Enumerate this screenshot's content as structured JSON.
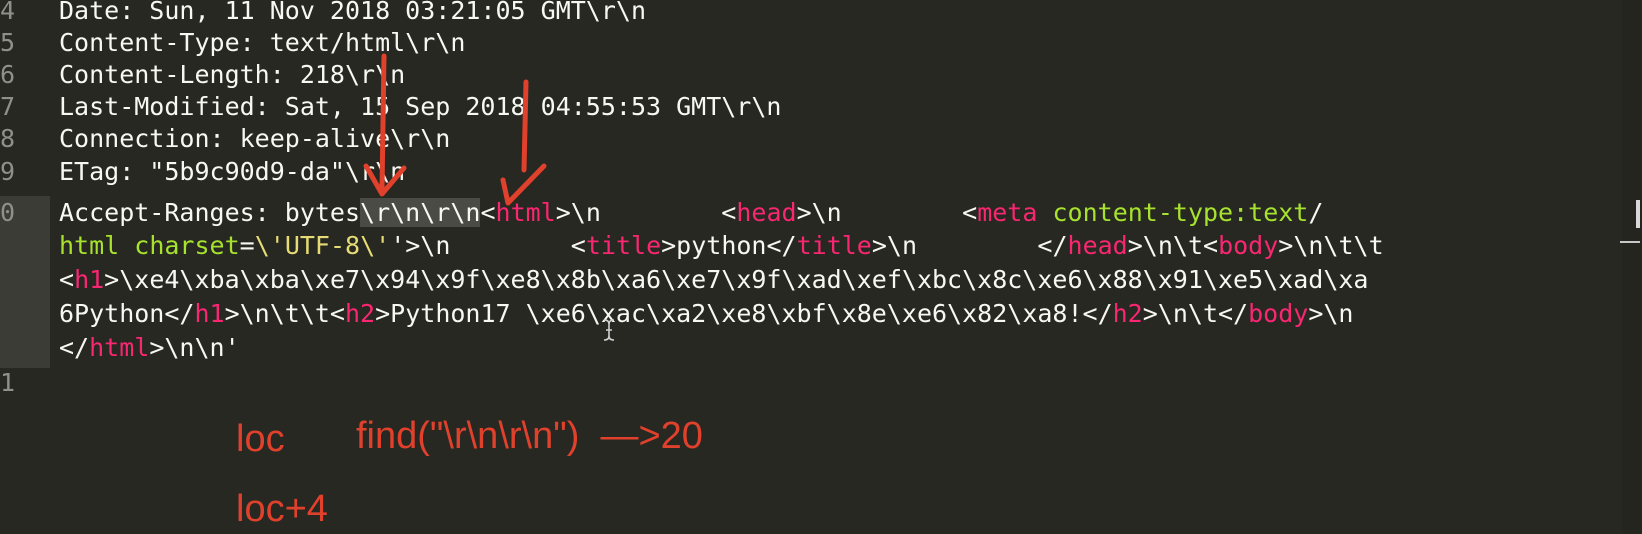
{
  "editor": {
    "line_numbers": [
      "4",
      "5",
      "6",
      "7",
      "8",
      "9",
      "0",
      "1"
    ],
    "lines": {
      "l4": "Date: Sun, 11 Nov 2018 03:21:05 GMT\\r\\n",
      "l5": "Content-Type: text/html\\r\\n",
      "l6": "Content-Length: 218\\r\\n",
      "l7": "Last-Modified: Sat, 15 Sep 2018 04:55:53 GMT\\r\\n",
      "l8": "Connection: keep-alive\\r\\n",
      "l9": "ETag: \"5b9c90d9-da\"\\r\\n",
      "l10": {
        "s1_prefix": "Accept-Ranges: bytes",
        "s1_selected": "\\r\\n\\r\\n",
        "s1_open1": "<",
        "s1_tag_html": "html",
        "s1_rest1": ">\\n        <",
        "s1_tag_head": "head",
        "s1_rest2": ">\\n        <",
        "s1_tag_meta": "meta",
        "s1_space": " ",
        "s1_attr": "content-type:text",
        "s1_slash": "/",
        "s2_attr2": "html",
        "s2_space": " ",
        "s2_attr3": "charset",
        "s2_eq": "=",
        "s2_q1": "\\'",
        "s2_val": "UTF-8",
        "s2_q2": "\\'",
        "s2_rest1": "'>\\n        <",
        "s2_tag_title": "title",
        "s2_rest2": ">python</",
        "s2_tag_title2": "title",
        "s2_rest3": ">\\n        </",
        "s2_tag_head2": "head",
        "s2_rest4": ">\\n\\t<",
        "s2_tag_body": "body",
        "s2_rest5": ">\\n\\t\\t",
        "s3_open": "<",
        "s3_tag_h1": "h1",
        "s3_rest": ">\\xe4\\xba\\xba\\xe7\\x94\\x9f\\xe8\\x8b\\xa6\\xe7\\x9f\\xad\\xef\\xbc\\x8c\\xe6\\x88\\x91\\xe5\\xad\\xa",
        "s4_rest1": "6Python</",
        "s4_tag_h1": "h1",
        "s4_rest2": ">\\n\\t\\t<",
        "s4_tag_h2": "h2",
        "s4_rest3": ">Python17 \\xe6\\xac\\xa2\\xe8\\xbf\\x8e\\xe6\\x82\\xa8!</",
        "s4_tag_h2b": "h2",
        "s4_rest4": ">\\n\\t</",
        "s4_tag_body": "body",
        "s4_rest5": ">\\n",
        "s5_rest1": "</",
        "s5_tag_html": "html",
        "s5_rest2": ">\\n\\n'"
      }
    }
  },
  "annotations": {
    "label_loc": "loc",
    "label_find": "find(\"\\r\\n\\r\\n\")  —>20",
    "label_loc4": "loc+4"
  },
  "colors": {
    "background": "#272822",
    "text": "#f8f8f2",
    "tag": "#f92672",
    "attribute": "#a6e22e",
    "string": "#e6db74",
    "line_number": "#8f908a",
    "annotation": "#e0412c"
  }
}
